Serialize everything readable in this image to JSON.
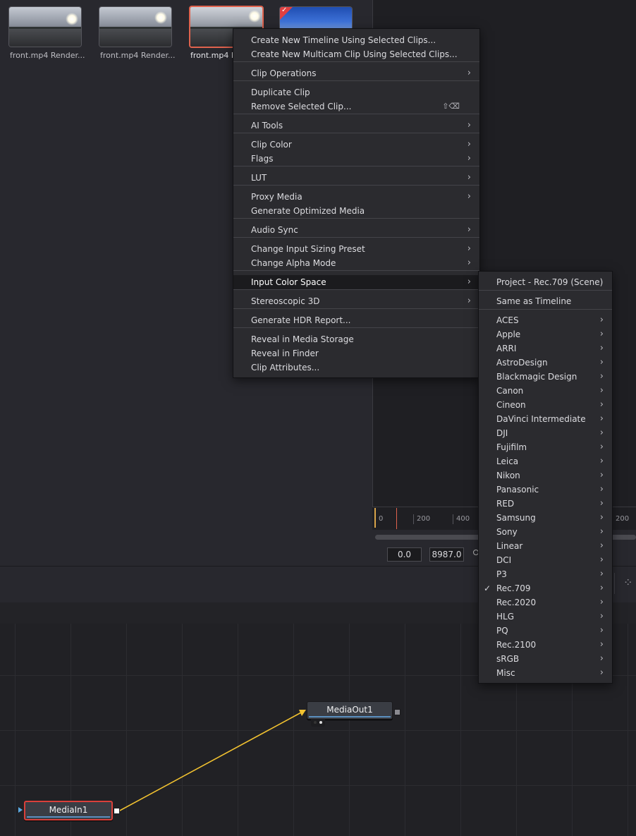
{
  "media_pool": {
    "clips": [
      {
        "label": "front.mp4 Render..."
      },
      {
        "label": "front.mp4 Render..."
      },
      {
        "label": "front.mp4 R"
      },
      {
        "label": ""
      }
    ]
  },
  "timeline_ruler": {
    "ticks": [
      "0",
      "200",
      "400",
      "200"
    ],
    "start_value": "0.0",
    "end_value": "8987.0"
  },
  "context_menu": {
    "items": [
      {
        "label": "Create New Timeline Using Selected Clips...",
        "submenu": false
      },
      {
        "label": "Create New Multicam Clip Using Selected Clips...",
        "submenu": false
      },
      {
        "label": "Clip Operations",
        "submenu": true
      },
      {
        "label": "Duplicate Clip",
        "submenu": false
      },
      {
        "label": "Remove Selected Clip...",
        "submenu": false,
        "shortcut": "⇧⌫"
      },
      {
        "label": "AI Tools",
        "submenu": true
      },
      {
        "label": "Clip Color",
        "submenu": true
      },
      {
        "label": "Flags",
        "submenu": true
      },
      {
        "label": "LUT",
        "submenu": true
      },
      {
        "label": "Proxy Media",
        "submenu": true
      },
      {
        "label": "Generate Optimized Media",
        "submenu": false
      },
      {
        "label": "Audio Sync",
        "submenu": true
      },
      {
        "label": "Change Input Sizing Preset",
        "submenu": true
      },
      {
        "label": "Change Alpha Mode",
        "submenu": true
      },
      {
        "label": "Input Color Space",
        "submenu": true,
        "highlighted": true
      },
      {
        "label": "Stereoscopic 3D",
        "submenu": true
      },
      {
        "label": "Generate HDR Report...",
        "submenu": false
      },
      {
        "label": "Reveal in Media Storage",
        "submenu": false
      },
      {
        "label": "Reveal in Finder",
        "submenu": false
      },
      {
        "label": "Clip Attributes...",
        "submenu": false
      }
    ]
  },
  "color_space_submenu": {
    "items": [
      {
        "label": "Project - Rec.709 (Scene)",
        "submenu": false
      },
      {
        "label": "Same as Timeline",
        "submenu": false
      },
      {
        "label": "ACES",
        "submenu": true
      },
      {
        "label": "Apple",
        "submenu": true
      },
      {
        "label": "ARRI",
        "submenu": true
      },
      {
        "label": "AstroDesign",
        "submenu": true
      },
      {
        "label": "Blackmagic Design",
        "submenu": true
      },
      {
        "label": "Canon",
        "submenu": true
      },
      {
        "label": "Cineon",
        "submenu": true
      },
      {
        "label": "DaVinci Intermediate",
        "submenu": true
      },
      {
        "label": "DJI",
        "submenu": true
      },
      {
        "label": "Fujifilm",
        "submenu": true
      },
      {
        "label": "Leica",
        "submenu": true
      },
      {
        "label": "Nikon",
        "submenu": true
      },
      {
        "label": "Panasonic",
        "submenu": true
      },
      {
        "label": "RED",
        "submenu": true
      },
      {
        "label": "Samsung",
        "submenu": true
      },
      {
        "label": "Sony",
        "submenu": true
      },
      {
        "label": "Linear",
        "submenu": true
      },
      {
        "label": "DCI",
        "submenu": true
      },
      {
        "label": "P3",
        "submenu": true
      },
      {
        "label": "Rec.709",
        "submenu": true,
        "checked": true
      },
      {
        "label": "Rec.2020",
        "submenu": true
      },
      {
        "label": "HLG",
        "submenu": true
      },
      {
        "label": "PQ",
        "submenu": true
      },
      {
        "label": "Rec.2100",
        "submenu": true
      },
      {
        "label": "sRGB",
        "submenu": true
      },
      {
        "label": "Misc",
        "submenu": true
      }
    ],
    "check_glyph": "✓"
  },
  "node_editor": {
    "nodes": {
      "media_in": "MediaIn1",
      "media_out": "MediaOut1"
    },
    "connection_color": "#f2c230"
  },
  "icons": {
    "chevron": "chevron-right-icon",
    "spinner": "spinner-icon"
  },
  "colors": {
    "selection": "#e0634e",
    "menu_bg": "#2b2b2f",
    "highlight_bg": "#1b1b1e"
  }
}
